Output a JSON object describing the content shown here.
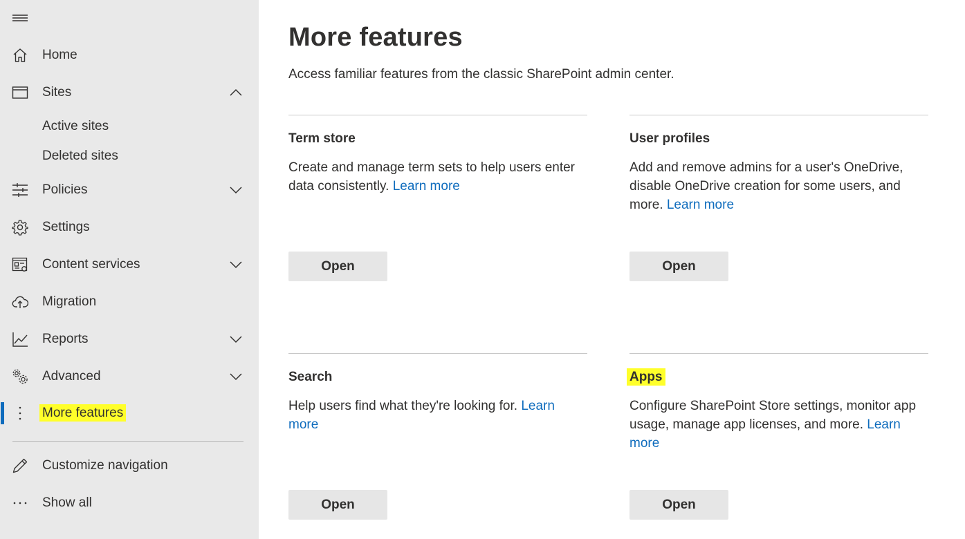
{
  "nav": {
    "items": [
      {
        "label": "Home"
      },
      {
        "label": "Sites"
      },
      {
        "label": "Active sites"
      },
      {
        "label": "Deleted sites"
      },
      {
        "label": "Policies"
      },
      {
        "label": "Settings"
      },
      {
        "label": "Content services"
      },
      {
        "label": "Migration"
      },
      {
        "label": "Reports"
      },
      {
        "label": "Advanced"
      },
      {
        "label": "More features"
      },
      {
        "label": "Customize navigation"
      },
      {
        "label": "Show all"
      }
    ]
  },
  "main": {
    "title": "More features",
    "description": "Access familiar features from the classic SharePoint admin center.",
    "cards": [
      {
        "title": "Term store",
        "text": "Create and manage term sets to help users enter data consistently.",
        "link": "Learn more",
        "button": "Open"
      },
      {
        "title": "User profiles",
        "text": "Add and remove admins for a user's OneDrive, disable OneDrive creation for some users, and more.",
        "link": "Learn more",
        "button": "Open"
      },
      {
        "title": "Search",
        "text": "Help users find what they're looking for.",
        "link": "Learn more",
        "button": "Open"
      },
      {
        "title": "Apps",
        "text": "Configure SharePoint Store settings, monitor app usage, manage app licenses, and more.",
        "link": "Learn more",
        "button": "Open"
      }
    ]
  },
  "colors": {
    "sidebar_bg": "#e9e9e9",
    "accent": "#0f6cbd",
    "highlight": "#ffff2a",
    "button_bg": "#e6e6e6"
  }
}
